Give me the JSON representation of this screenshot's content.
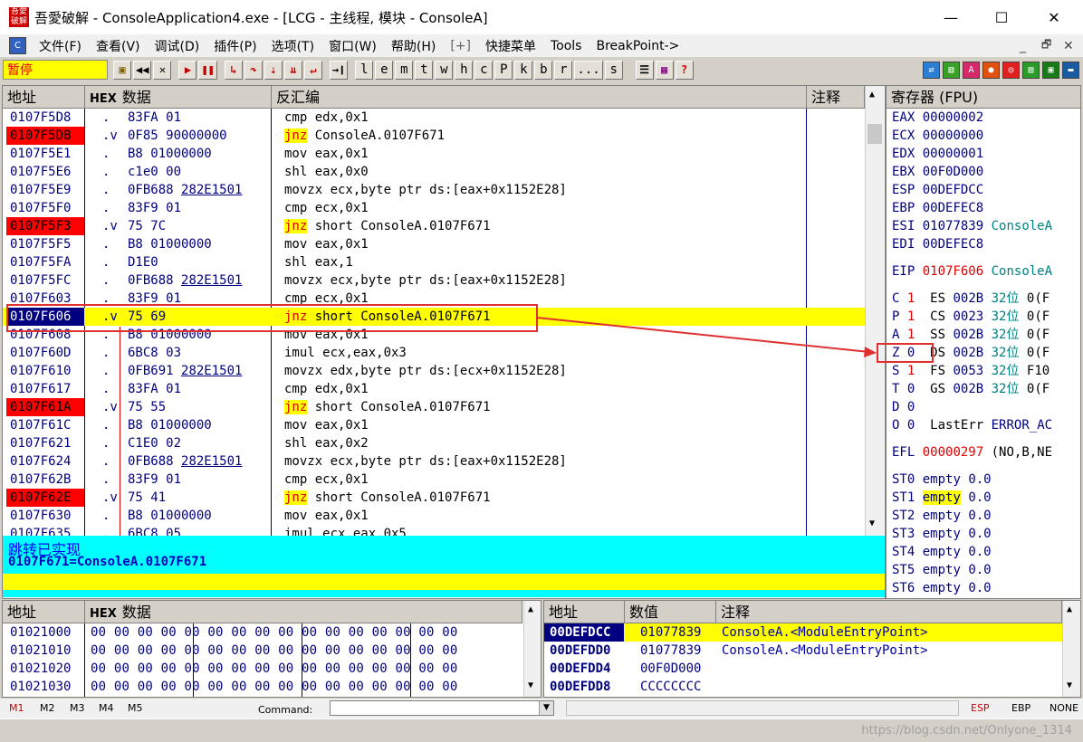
{
  "title": {
    "text": "吾愛破解 - ConsoleApplication4.exe - [LCG - 主线程, 模块 - ConsoleA]",
    "logo": "吾愛破解"
  },
  "window_controls": {
    "minimize": "—",
    "maximize": "☐",
    "close": "✕"
  },
  "menu": [
    "文件(F)",
    "查看(V)",
    "调试(D)",
    "插件(P)",
    "选项(T)",
    "窗口(W)",
    "帮助(H)",
    "[+]",
    "快捷菜单",
    "Tools",
    "BreakPoint->"
  ],
  "menu_right": {
    "minimize": "_",
    "restore": "🗗",
    "close": "✕"
  },
  "toolbar": {
    "status": "暂停",
    "letters": [
      "l",
      "e",
      "m",
      "t",
      "w",
      "h",
      "c",
      "P",
      "k",
      "b",
      "r",
      "...",
      "s"
    ]
  },
  "cpu": {
    "headers": {
      "addr": "地址",
      "hex_prefix": "HEX",
      "hex": "数据",
      "disasm": "反汇编",
      "comment": "注释"
    },
    "rows": [
      {
        "addr": "0107F5D8",
        "mark": ".",
        "hex": "83FA 01",
        "dis": "cmp edx,0x1"
      },
      {
        "addr": "0107F5DB",
        "mark": ".v",
        "hex": "0F85 90000000",
        "jnz": "jnz",
        "dis": " ConsoleA.0107F671",
        "red": true
      },
      {
        "addr": "0107F5E1",
        "mark": ".",
        "hex": "B8 01000000",
        "dis": "mov eax,0x1"
      },
      {
        "addr": "0107F5E6",
        "mark": ".",
        "hex": "c1e0 00",
        "dis": "shl eax,0x0"
      },
      {
        "addr": "0107F5E9",
        "mark": ".",
        "hex": "0FB688",
        "hexu": "282E1501",
        "dis": "movzx ecx,byte ptr ds:[eax+0x1152E28]"
      },
      {
        "addr": "0107F5F0",
        "mark": ".",
        "hex": "83F9 01",
        "dis": "cmp ecx,0x1"
      },
      {
        "addr": "0107F5F3",
        "mark": ".v",
        "hex": "75 7C",
        "jnz": "jnz",
        "dis": " short ConsoleA.0107F671",
        "red": true
      },
      {
        "addr": "0107F5F5",
        "mark": ".",
        "hex": "B8 01000000",
        "dis": "mov eax,0x1"
      },
      {
        "addr": "0107F5FA",
        "mark": ".",
        "hex": "D1E0",
        "dis": "shl eax,1"
      },
      {
        "addr": "0107F5FC",
        "mark": ".",
        "hex": "0FB688",
        "hexu": "282E1501",
        "dis": "movzx ecx,byte ptr ds:[eax+0x1152E28]"
      },
      {
        "addr": "0107F603",
        "mark": ".",
        "hex": "83F9 01",
        "dis": "cmp ecx,0x1"
      },
      {
        "addr": "0107F606",
        "mark": ".v",
        "hex": "75 69",
        "jnz": "jnz",
        "dis": " short ConsoleA.0107F671",
        "cur": true,
        "hl": true
      },
      {
        "addr": "0107F608",
        "mark": ".",
        "hex": "B8 01000000",
        "dis": "mov eax,0x1"
      },
      {
        "addr": "0107F60D",
        "mark": ".",
        "hex": "6BC8 03",
        "dis": "imul ecx,eax,0x3"
      },
      {
        "addr": "0107F610",
        "mark": ".",
        "hex": "0FB691",
        "hexu": "282E1501",
        "dis": "movzx edx,byte ptr ds:[ecx+0x1152E28]"
      },
      {
        "addr": "0107F617",
        "mark": ".",
        "hex": "83FA 01",
        "dis": "cmp edx,0x1"
      },
      {
        "addr": "0107F61A",
        "mark": ".v",
        "hex": "75 55",
        "jnz": "jnz",
        "dis": " short ConsoleA.0107F671",
        "red": true
      },
      {
        "addr": "0107F61C",
        "mark": ".",
        "hex": "B8 01000000",
        "dis": "mov eax,0x1"
      },
      {
        "addr": "0107F621",
        "mark": ".",
        "hex": "C1E0 02",
        "dis": "shl eax,0x2"
      },
      {
        "addr": "0107F624",
        "mark": ".",
        "hex": "0FB688",
        "hexu": "282E1501",
        "dis": "movzx ecx,byte ptr ds:[eax+0x1152E28]"
      },
      {
        "addr": "0107F62B",
        "mark": ".",
        "hex": "83F9 01",
        "dis": "cmp ecx,0x1"
      },
      {
        "addr": "0107F62E",
        "mark": ".v",
        "hex": "75 41",
        "jnz": "jnz",
        "dis": " short ConsoleA.0107F671",
        "red": true
      },
      {
        "addr": "0107F630",
        "mark": ".",
        "hex": "B8 01000000",
        "dis": "mov eax,0x1"
      },
      {
        "addr": "0107F635",
        "mark": ".",
        "hex": "6BC8 05",
        "dis": "imul ecx,eax,0x5"
      }
    ],
    "info_line1": "跳转已实现",
    "info_line2": "0107F671=ConsoleA.0107F671"
  },
  "registers": {
    "header": "寄存器 (FPU)",
    "gp": [
      {
        "name": "EAX",
        "value": "00000002",
        "extra": ""
      },
      {
        "name": "ECX",
        "value": "00000000",
        "extra": ""
      },
      {
        "name": "EDX",
        "value": "00000001",
        "extra": ""
      },
      {
        "name": "EBX",
        "value": "00F0D000",
        "extra": ""
      },
      {
        "name": "ESP",
        "value": "00DEFDCC",
        "extra": ""
      },
      {
        "name": "EBP",
        "value": "00DEFEC8",
        "extra": ""
      },
      {
        "name": "ESI",
        "value": "01077839",
        "extra": "ConsoleA"
      },
      {
        "name": "EDI",
        "value": "00DEFEC8",
        "extra": ""
      }
    ],
    "eip": {
      "name": "EIP",
      "value": "0107F606",
      "extra": "ConsoleA"
    },
    "flags": [
      {
        "f": "C",
        "v": "1",
        "seg": "ES",
        "sv": "002B",
        "bits": "32位",
        "tail": "0(F"
      },
      {
        "f": "P",
        "v": "1",
        "seg": "CS",
        "sv": "0023",
        "bits": "32位",
        "tail": "0(F"
      },
      {
        "f": "A",
        "v": "1",
        "seg": "SS",
        "sv": "002B",
        "bits": "32位",
        "tail": "0(F"
      },
      {
        "f": "Z",
        "v": "0",
        "seg": "DS",
        "sv": "002B",
        "bits": "32位",
        "tail": "0(F"
      },
      {
        "f": "S",
        "v": "1",
        "seg": "FS",
        "sv": "0053",
        "bits": "32位",
        "tail": "F10"
      },
      {
        "f": "T",
        "v": "0",
        "seg": "GS",
        "sv": "002B",
        "bits": "32位",
        "tail": "0(F"
      },
      {
        "f": "D",
        "v": "0",
        "seg": "",
        "sv": "",
        "bits": "",
        "tail": ""
      },
      {
        "f": "O",
        "v": "0",
        "seg": "LastErr",
        "sv": "ERROR_AC",
        "bits": "",
        "tail": ""
      }
    ],
    "efl": {
      "name": "EFL",
      "value": "00000297",
      "extra": "(NO,B,NE"
    },
    "fpu": [
      {
        "name": "ST0",
        "state": "empty",
        "val": "0.0"
      },
      {
        "name": "ST1",
        "state": "empty",
        "val": "0.0",
        "hl": true
      },
      {
        "name": "ST2",
        "state": "empty",
        "val": "0.0"
      },
      {
        "name": "ST3",
        "state": "empty",
        "val": "0.0"
      },
      {
        "name": "ST4",
        "state": "empty",
        "val": "0.0"
      },
      {
        "name": "ST5",
        "state": "empty",
        "val": "0.0"
      },
      {
        "name": "ST6",
        "state": "empty",
        "val": "0.0"
      }
    ]
  },
  "dump": {
    "headers": {
      "addr": "地址",
      "hex_prefix": "HEX",
      "hex": "数据"
    },
    "rows": [
      {
        "addr": "01021000",
        "bytes": "00 00 00 00 00 00 00 00 00 00 00 00 00 00 00 00"
      },
      {
        "addr": "01021010",
        "bytes": "00 00 00 00 00 00 00 00 00 00 00 00 00 00 00 00"
      },
      {
        "addr": "01021020",
        "bytes": "00 00 00 00 00 00 00 00 00 00 00 00 00 00 00 00"
      },
      {
        "addr": "01021030",
        "bytes": "00 00 00 00 00 00 00 00 00 00 00 00 00 00 00 00"
      }
    ]
  },
  "stack": {
    "headers": {
      "addr": "地址",
      "value": "数值",
      "comment": "注释"
    },
    "rows": [
      {
        "addr": "00DEFDCC",
        "value": "01077839",
        "comment": "ConsoleA.<ModuleEntryPoint>",
        "sel": true
      },
      {
        "addr": "00DEFDD0",
        "value": "01077839",
        "comment": "ConsoleA.<ModuleEntryPoint>"
      },
      {
        "addr": "00DEFDD4",
        "value": "00F0D000",
        "comment": ""
      },
      {
        "addr": "00DEFDD8",
        "value": "CCCCCCCC",
        "comment": ""
      }
    ]
  },
  "cmdbar": {
    "tabs": [
      "M1",
      "M2",
      "M3",
      "M4",
      "M5"
    ],
    "command_label": "Command:",
    "right": [
      "ESP",
      "EBP",
      "NONE"
    ]
  },
  "watermark": "https://blog.csdn.net/Onlyone_1314"
}
